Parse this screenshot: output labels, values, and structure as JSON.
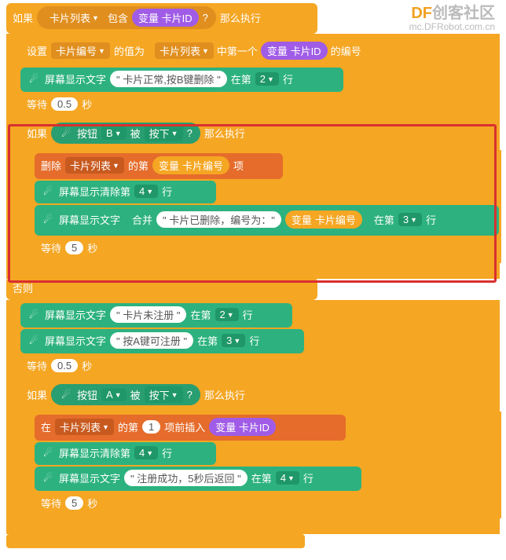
{
  "watermark": {
    "brand_prefix": "DF",
    "brand": "创客社区",
    "url": "mc.DFRobot.com.cn"
  },
  "if1": {
    "kw_if": "如果",
    "list": "卡片列表",
    "contains": "包含",
    "var_lbl": "变量",
    "var_name": "卡片ID",
    "q": "?",
    "then": "那么执行"
  },
  "set": {
    "kw": "设置",
    "var": "卡片编号",
    "to": "的值为",
    "list": "卡片列表",
    "first": "中第一个",
    "var_lbl": "变量",
    "var_name": "卡片ID",
    "idx": "的编号"
  },
  "disp1": {
    "kw": "屏幕显示文字",
    "text": "\" 卡片正常,按B键删除 \"",
    "at": "在第",
    "line": "2",
    "row": "行"
  },
  "wait1": {
    "kw": "等待",
    "sec": "0.5",
    "unit": "秒"
  },
  "if2": {
    "kw_if": "如果",
    "btn_kw": "按钮",
    "btn": "B",
    "be": "被",
    "pressed": "按下",
    "q": "?",
    "then": "那么执行"
  },
  "del": {
    "kw": "删除",
    "list": "卡片列表",
    "of": "的第",
    "var_lbl": "变量",
    "var_name": "卡片编号",
    "item": "项"
  },
  "clr1": {
    "kw": "屏幕显示清除第",
    "line": "4",
    "row": "行"
  },
  "disp2": {
    "kw": "屏幕显示文字",
    "join": "合并",
    "text": "\" 卡片已删除，编号为：\"",
    "var_lbl": "变量",
    "var_name": "卡片编号",
    "at": "在第",
    "line": "3",
    "row": "行"
  },
  "wait2": {
    "kw": "等待",
    "sec": "5",
    "unit": "秒"
  },
  "else": {
    "kw": "否则"
  },
  "disp3": {
    "kw": "屏幕显示文字",
    "text": "\" 卡片未注册 \"",
    "at": "在第",
    "line": "2",
    "row": "行"
  },
  "disp4": {
    "kw": "屏幕显示文字",
    "text": "\" 按A键可注册 \"",
    "at": "在第",
    "line": "3",
    "row": "行"
  },
  "wait3": {
    "kw": "等待",
    "sec": "0.5",
    "unit": "秒"
  },
  "if3": {
    "kw_if": "如果",
    "btn_kw": "按钮",
    "btn": "A",
    "be": "被",
    "pressed": "按下",
    "q": "?",
    "then": "那么执行"
  },
  "ins": {
    "at": "在",
    "list": "卡片列表",
    "of": "的第",
    "idx": "1",
    "before": "项前插入",
    "var_lbl": "变量",
    "var_name": "卡片ID"
  },
  "clr2": {
    "kw": "屏幕显示清除第",
    "line": "4",
    "row": "行"
  },
  "disp5": {
    "kw": "屏幕显示文字",
    "text": "\" 注册成功，5秒后返回 \"",
    "at": "在第",
    "line": "4",
    "row": "行"
  },
  "wait4": {
    "kw": "等待",
    "sec": "5",
    "unit": "秒"
  }
}
